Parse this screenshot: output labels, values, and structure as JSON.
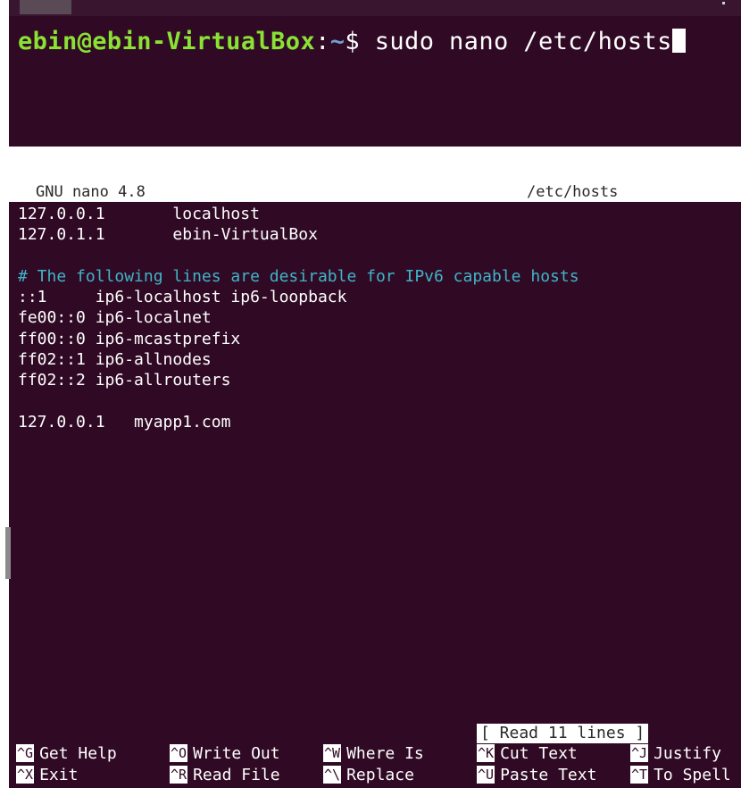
{
  "terminal_top": {
    "prompt_user_host": "ebin@ebin-VirtualBox",
    "prompt_sep": ":",
    "prompt_path": "~",
    "prompt_dollar": "$ ",
    "command": "sudo nano /etc/hosts"
  },
  "nano": {
    "version": "GNU nano 4.8",
    "filename": "/etc/hosts",
    "status": "[ Read 11 lines ]",
    "lines": [
      {
        "text": "127.0.0.1       localhost",
        "type": "normal"
      },
      {
        "text": "127.0.1.1       ebin-VirtualBox",
        "type": "normal"
      },
      {
        "text": "",
        "type": "normal"
      },
      {
        "text": "# The following lines are desirable for IPv6 capable hosts",
        "type": "comment"
      },
      {
        "text": "::1     ip6-localhost ip6-loopback",
        "type": "normal"
      },
      {
        "text": "fe00::0 ip6-localnet",
        "type": "normal"
      },
      {
        "text": "ff00::0 ip6-mcastprefix",
        "type": "normal"
      },
      {
        "text": "ff02::1 ip6-allnodes",
        "type": "normal"
      },
      {
        "text": "ff02::2 ip6-allrouters",
        "type": "normal"
      },
      {
        "text": "",
        "type": "normal"
      },
      {
        "text": "127.0.0.1   myapp1.com",
        "type": "normal"
      }
    ],
    "shortcuts_row1": [
      {
        "key": "^G",
        "label": "Get Help"
      },
      {
        "key": "^O",
        "label": "Write Out"
      },
      {
        "key": "^W",
        "label": "Where Is"
      },
      {
        "key": "^K",
        "label": "Cut Text"
      },
      {
        "key": "^J",
        "label": "Justify"
      }
    ],
    "shortcuts_row2": [
      {
        "key": "^X",
        "label": "Exit"
      },
      {
        "key": "^R",
        "label": "Read File"
      },
      {
        "key": "^\\",
        "label": "Replace"
      },
      {
        "key": "^U",
        "label": "Paste Text"
      },
      {
        "key": "^T",
        "label": "To Spell"
      }
    ]
  },
  "colors": {
    "terminal_bg": "#300a24",
    "prompt_user": "#8ae234",
    "prompt_path": "#729fcf",
    "comment": "#3fb4c8"
  }
}
